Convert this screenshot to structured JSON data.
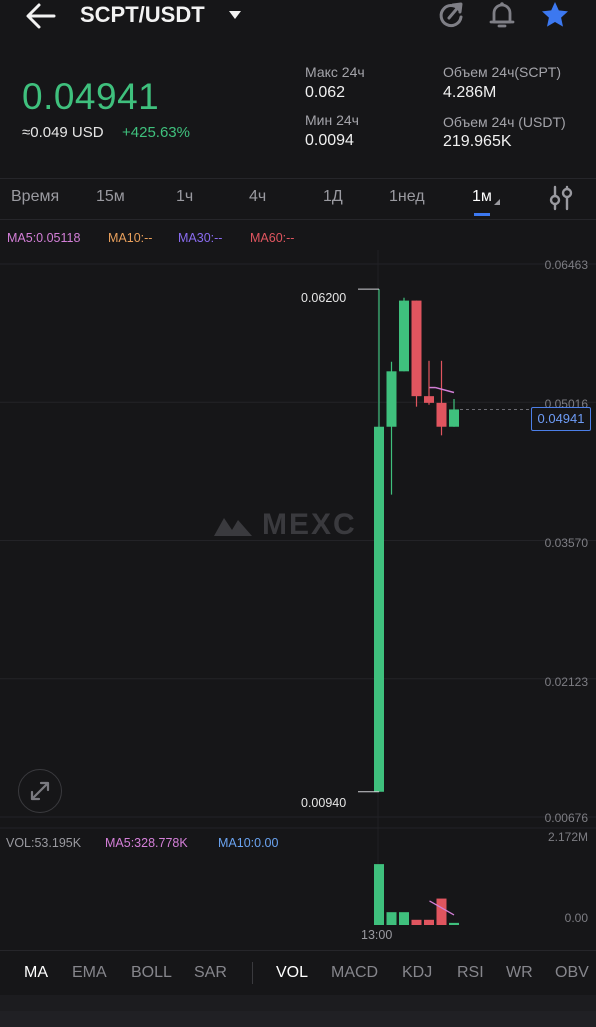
{
  "header": {
    "pair": "SCPT/USDT"
  },
  "price": {
    "last": "0.04941",
    "approx_usd": "≈0.049 USD",
    "change": "+425.63%"
  },
  "stats": {
    "high_label": "Макс 24ч",
    "high_value": "0.062",
    "low_label": "Мин 24ч",
    "low_value": "0.0094",
    "vol_base_label": "Объем 24ч(SCPT)",
    "vol_base_value": "4.286M",
    "vol_quote_label": "Объем 24ч (USDT)",
    "vol_quote_value": "219.965K"
  },
  "tabs": [
    "Время",
    "15м",
    "1ч",
    "4ч",
    "1Д",
    "1нед",
    "1м"
  ],
  "active_tab": "1м",
  "ma_indicators": {
    "ma5": "MA5:0.05118",
    "ma10": "MA10:--",
    "ma30": "MA30:--",
    "ma60": "MA60:--"
  },
  "price_axis": [
    "0.06463",
    "0.05016",
    "0.03570",
    "0.02123",
    "0.00676"
  ],
  "chart_labels": {
    "high_marker": "0.06200",
    "low_marker": "0.00940",
    "current_price": "0.04941"
  },
  "watermark": "MEXC",
  "volume": {
    "vol": "VOL:53.195K",
    "ma5": "MA5:328.778K",
    "ma10": "MA10:0.00",
    "axis_top": "2.172M",
    "axis_bottom": "0.00",
    "time": "13:00"
  },
  "indicators_main": [
    "MA",
    "EMA",
    "BOLL",
    "SAR"
  ],
  "indicators_sub": [
    "VOL",
    "MACD",
    "KDJ",
    "RSI",
    "WR",
    "OBV"
  ],
  "colors": {
    "up": "#3fc07d",
    "down": "#e0555f",
    "accent": "#3c78f0",
    "ma5": "#d47fd8",
    "ma10": "#e9a05c",
    "ma30": "#8a6cf0",
    "ma60": "#e0555f",
    "ma10_vol": "#6aa3f0"
  },
  "icons": [
    "back-arrow-icon",
    "dropdown-caret-icon",
    "share-icon",
    "bell-icon",
    "star-icon",
    "settings-sliders-icon",
    "expand-icon"
  ],
  "chart_data": {
    "type": "candlestick",
    "interval": "1м",
    "ylim": [
      0.00676,
      0.06463
    ],
    "candles": [
      {
        "open": 0.0094,
        "close": 0.0476,
        "high": 0.062,
        "low": 0.0094
      },
      {
        "open": 0.0476,
        "close": 0.0534,
        "high": 0.0544,
        "low": 0.0405
      },
      {
        "open": 0.0534,
        "close": 0.0608,
        "high": 0.0611,
        "low": 0.0534
      },
      {
        "open": 0.0608,
        "close": 0.0508,
        "high": 0.0608,
        "low": 0.0497
      },
      {
        "open": 0.0508,
        "close": 0.0501,
        "high": 0.0545,
        "low": 0.0499
      },
      {
        "open": 0.0501,
        "close": 0.0476,
        "high": 0.0545,
        "low": 0.0467
      },
      {
        "open": 0.0476,
        "close": 0.04941,
        "high": 0.0505,
        "low": 0.0476
      }
    ],
    "ma5_points": [
      0.0517,
      0.05118
    ],
    "volume": [
      {
        "value": 1.52,
        "up": true
      },
      {
        "value": 0.32,
        "up": true
      },
      {
        "value": 0.32,
        "up": true
      },
      {
        "value": 0.13,
        "up": false
      },
      {
        "value": 0.13,
        "up": false
      },
      {
        "value": 0.66,
        "up": false
      },
      {
        "value": 0.053,
        "up": true
      }
    ],
    "volume_ylim": [
      0,
      2.172
    ]
  }
}
